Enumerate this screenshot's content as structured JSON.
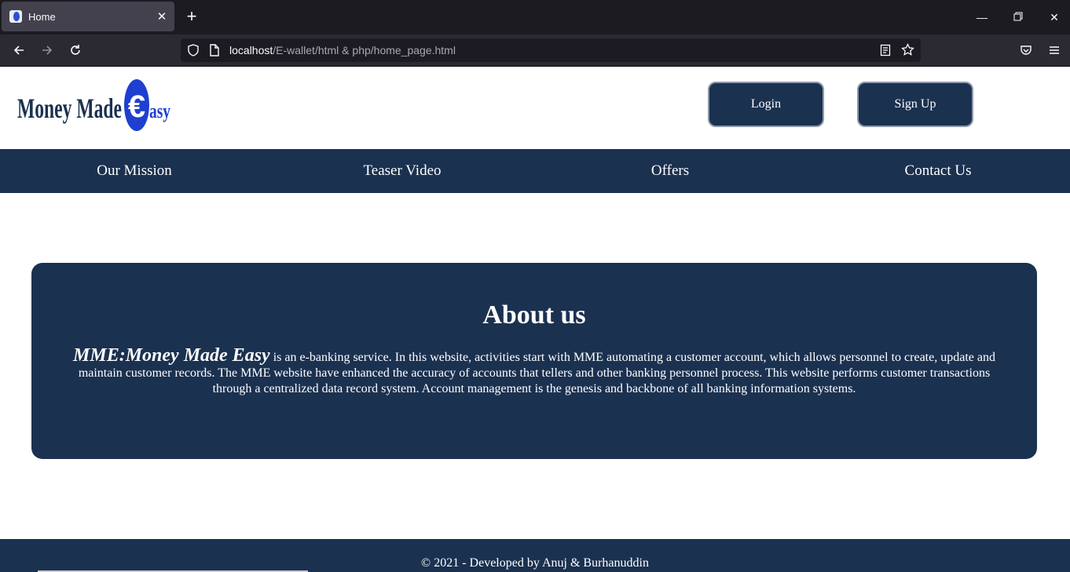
{
  "browser": {
    "tab_title": "Home",
    "url_host": "localhost",
    "url_path": "/E-wallet/html & php/home_page.html"
  },
  "header": {
    "logo_text_main": "Money Made ",
    "logo_text_tail": "asy",
    "logo_symbol": "€",
    "login_label": "Login",
    "signup_label": "Sign Up"
  },
  "menu": {
    "items": [
      {
        "label": "Our Mission"
      },
      {
        "label": "Teaser Video"
      },
      {
        "label": "Offers"
      },
      {
        "label": "Contact Us"
      }
    ]
  },
  "about": {
    "title": "About us",
    "brand": "MME:Money Made Easy",
    "body": " is an e-banking service. In this website, activities start with MME automating a customer account, which allows personnel to create, update and maintain customer records. The MME website have enhanced the accuracy of accounts that tellers and other banking personnel process. This website performs customer transactions through a centralized data record system. Account management is the genesis and backbone of all banking information systems."
  },
  "footer": {
    "text": "© 2021 - Developed by Anuj & Burhanuddin"
  },
  "colors": {
    "brand_navy": "#1b3150",
    "logo_blue": "#1f3fd0",
    "chrome_dark": "#1c1b22"
  }
}
